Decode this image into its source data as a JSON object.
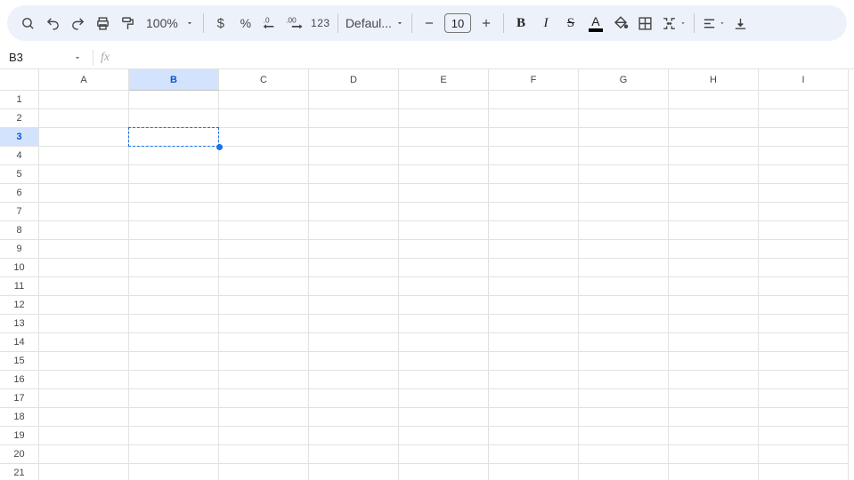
{
  "toolbar": {
    "zoom": "100%",
    "font_name": "Defaul...",
    "font_size": "10",
    "number_label": "123"
  },
  "namebox": {
    "value": "B3"
  },
  "columns": [
    "A",
    "B",
    "C",
    "D",
    "E",
    "F",
    "G",
    "H",
    "I"
  ],
  "rows": [
    "1",
    "2",
    "3",
    "4",
    "5",
    "6",
    "7",
    "8",
    "9",
    "10",
    "11",
    "12",
    "13",
    "14",
    "15",
    "16",
    "17",
    "18",
    "19",
    "20",
    "21"
  ],
  "selection": {
    "col_index": 1,
    "row_index": 2
  }
}
